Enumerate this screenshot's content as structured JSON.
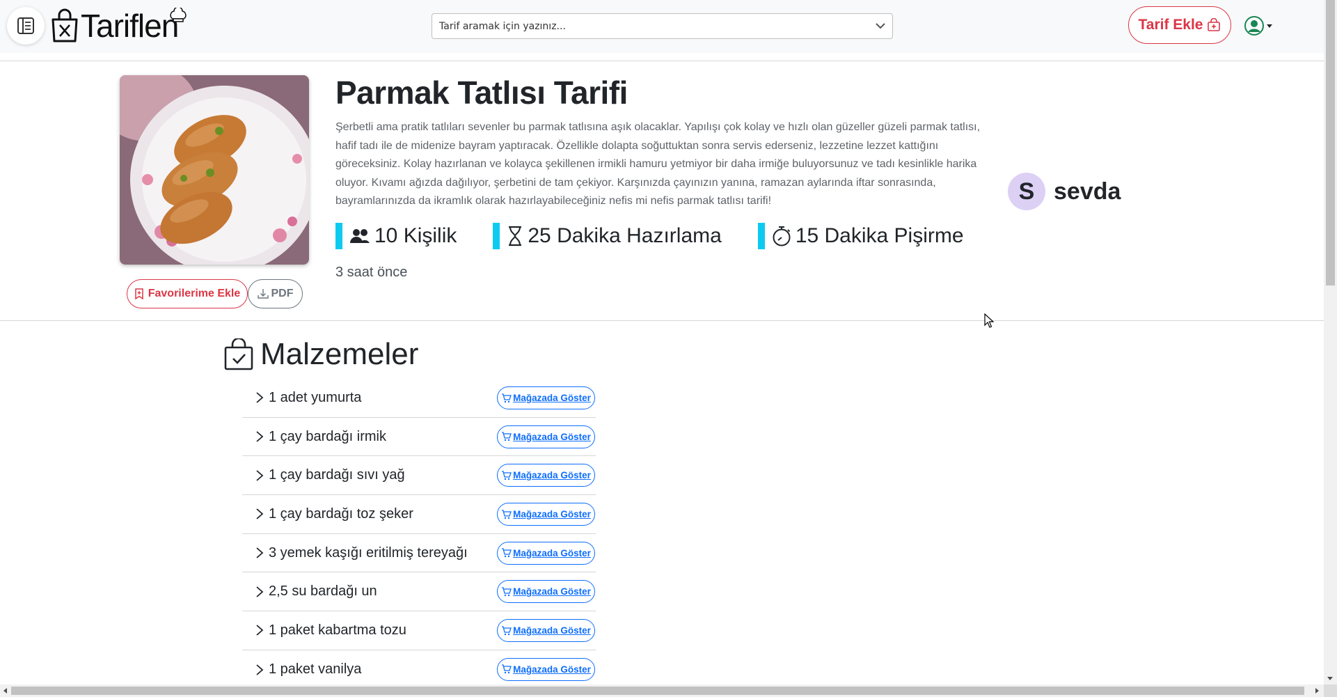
{
  "header": {
    "logo_text": "Tariflen",
    "search_placeholder": "Tarif aramak için yazınız...",
    "add_recipe_label": "Tarif Ekle"
  },
  "recipe": {
    "title": "Parmak Tatlısı Tarifi",
    "description": "Şerbetli ama pratik tatlıları sevenler bu parmak tatlısına aşık olacaklar. Yapılışı çok kolay ve hızlı olan güzeller güzeli parmak tatlısı, hafif tadı ile de midenize bayram yaptıracak. Özellikle dolapta soğuttuktan sonra servis ederseniz, lezzetine lezzet kattığını göreceksiniz. Kolay hazırlanan ve kolayca şekillenen irmikli hamuru yetmiyor bir daha irmiğe buluyorsunuz ve tadı kesinlikle harika oluyor. Kıvamı ağızda dağılıyor, şerbetini de tam çekiyor. Karşınızda çayınızın yanına, ramazan aylarında iftar sonrasında, bayramlarınızda da ikramlık olarak hazırlayabileceğiniz nefis mi nefis parmak tatlısı tarifi!",
    "servings": "10 Kişilik",
    "prep_time": "25 Dakika Hazırlama",
    "cook_time": "15 Dakika Pişirme",
    "time_ago": "3 saat önce",
    "favorite_label": "Favorilerime Ekle",
    "pdf_label": "PDF",
    "stat_accent_color": "#0dcaf0"
  },
  "author": {
    "initial": "S",
    "name": "sevda",
    "avatar_color": "#ddd0f5"
  },
  "ingredients": {
    "heading": "Malzemeler",
    "store_button_label": "Mağazada Göster",
    "items": [
      {
        "name": "1 adet yumurta"
      },
      {
        "name": "1 çay bardağı irmik"
      },
      {
        "name": "1 çay bardağı sıvı yağ"
      },
      {
        "name": "1 çay bardağı toz şeker"
      },
      {
        "name": "3 yemek kaşığı eritilmiş tereyağı"
      },
      {
        "name": "2,5 su bardağı un"
      },
      {
        "name": "1 paket kabartma tozu"
      },
      {
        "name": "1 paket vanilya"
      }
    ]
  },
  "colors": {
    "danger": "#dc3545",
    "primary": "#0d6efd",
    "muted": "#6c757d"
  }
}
